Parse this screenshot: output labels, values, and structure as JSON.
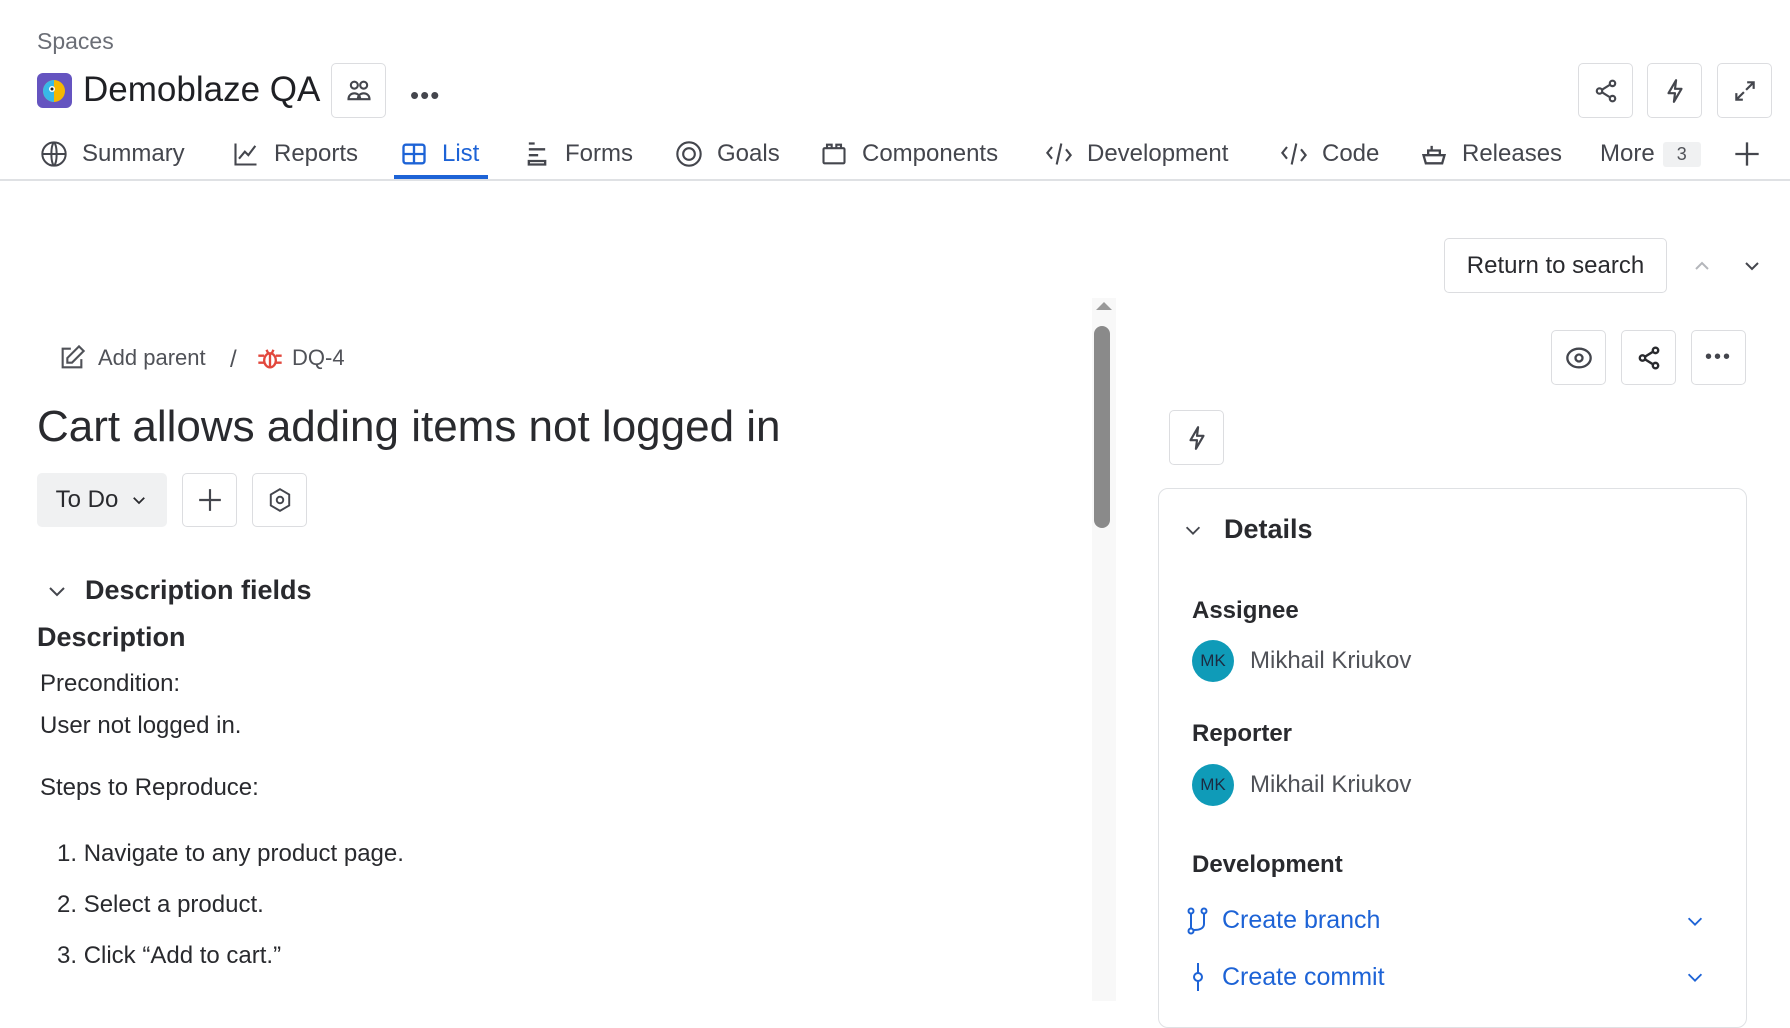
{
  "header": {
    "breadcrumb": "Spaces",
    "title": "Demoblaze QA"
  },
  "tabs": [
    {
      "label": "Summary",
      "icon": "globe-icon"
    },
    {
      "label": "Reports",
      "icon": "chart-line-icon"
    },
    {
      "label": "List",
      "icon": "table-icon",
      "active": true
    },
    {
      "label": "Forms",
      "icon": "form-icon"
    },
    {
      "label": "Goals",
      "icon": "target-icon"
    },
    {
      "label": "Components",
      "icon": "component-icon"
    },
    {
      "label": "Development",
      "icon": "code-icon"
    },
    {
      "label": "Code",
      "icon": "code-icon"
    },
    {
      "label": "Releases",
      "icon": "ship-icon"
    }
  ],
  "more": {
    "label": "More",
    "count": "3"
  },
  "nav": {
    "return_label": "Return to search"
  },
  "issue": {
    "add_parent": "Add parent",
    "separator": "/",
    "key": "DQ-4",
    "title": "Cart allows adding items not logged in",
    "status": "To Do",
    "section_title": "Description fields",
    "description_label": "Description",
    "precondition_label": "Precondition:",
    "precondition": "User not logged in.",
    "steps_label": "Steps to Reproduce:",
    "steps": [
      "Navigate to any product page.",
      "Select a product.",
      "Click “Add to cart.”"
    ]
  },
  "details": {
    "title": "Details",
    "assignee_label": "Assignee",
    "assignee": {
      "initials": "MK",
      "name": "Mikhail Kriukov"
    },
    "reporter_label": "Reporter",
    "reporter": {
      "initials": "MK",
      "name": "Mikhail Kriukov"
    },
    "development_label": "Development",
    "create_branch": "Create branch",
    "create_commit": "Create commit"
  },
  "colors": {
    "accent": "#1d63d6",
    "avatar": "#0f9bb8",
    "bug": "#e2483d",
    "logo": "#6554c0"
  }
}
